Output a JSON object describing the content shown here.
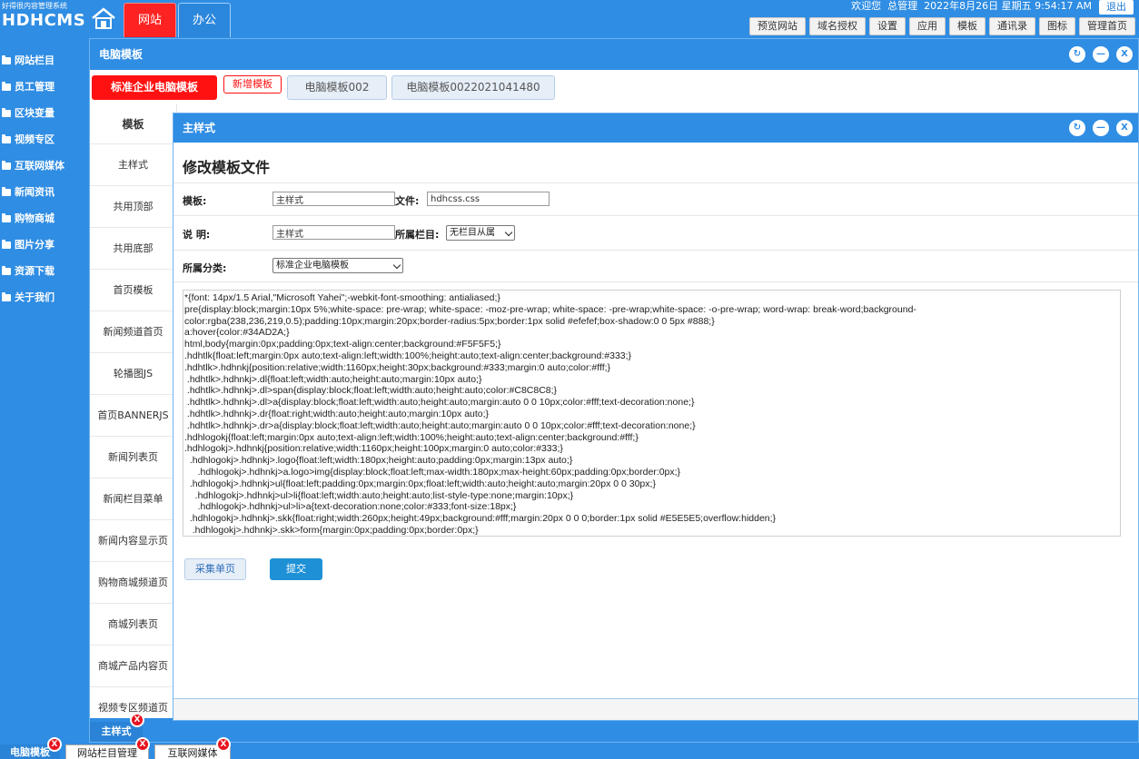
{
  "brand": {
    "subtitle": "好得很内容管理系统",
    "name": "HDHCMS"
  },
  "top_tabs": [
    "网站",
    "办公"
  ],
  "user": {
    "welcome": "欢迎您",
    "name": "总管理",
    "datetime": "2022年8月26日 星期五 9:54:17 AM",
    "logout": "退出"
  },
  "toolbar": [
    "预览网站",
    "域名授权",
    "设置",
    "应用",
    "模板",
    "通讯录",
    "图标",
    "管理首页"
  ],
  "left_nav": [
    "网站栏目",
    "员工管理",
    "区块变量",
    "视频专区",
    "互联网媒体",
    "新闻资讯",
    "购物商城",
    "图片分享",
    "资源下载",
    "关于我们"
  ],
  "outer_window": {
    "title": "电脑模板",
    "sub_tabs": [
      "标准企业电脑模板",
      "新增模板",
      "电脑模板002",
      "电脑模板0022021041480"
    ],
    "template_list_header": "模板",
    "template_list": [
      "主样式",
      "共用顶部",
      "共用底部",
      "首页模板",
      "新闻频道首页",
      "轮播图JS",
      "首页BANNERJS",
      "新闻列表页",
      "新闻栏目菜单",
      "新闻内容显示页",
      "购物商城频道页",
      "商城列表页",
      "商城产品内容页",
      "视频专区频道页"
    ],
    "inner_tab": "主样式"
  },
  "inner_window": {
    "title": "主样式",
    "form_title": "修改模板文件",
    "fields": {
      "template_label": "模板:",
      "template_value": "主样式",
      "file_label": "文件:",
      "file_value": "hdhcss.css",
      "desc_label": "说 明:",
      "desc_value": "主样式",
      "column_label": "所属栏目:",
      "column_value": "无栏目从属",
      "category_label": "所属分类:",
      "category_value": "标准企业电脑模板"
    },
    "code": "*{font: 14px/1.5 Arial,\"Microsoft Yahei\";-webkit-font-smoothing: antialiased;}\npre{display:block;margin:10px 5%;white-space: pre-wrap; white-space: -moz-pre-wrap; white-space: -pre-wrap;white-space: -o-pre-wrap; word-wrap: break-word;background-\ncolor:rgba(238,236,219,0.5);padding:10px;margin:20px;border-radius:5px;border:1px solid #efefef;box-shadow:0 0 5px #888;}\na:hover{color:#34AD2A;}\nhtml,body{margin:0px;padding:0px;text-align:center;background:#F5F5F5;}\n.hdhtlk{float:left;margin:0px auto;text-align:left;width:100%;height:auto;text-align:center;background:#333;}\n.hdhtlk>.hdhnkj{position:relative;width:1160px;height:30px;background:#333;margin:0 auto;color:#fff;}\n .hdhtlk>.hdhnkj>.dl{float:left;width:auto;height:auto;margin:10px auto;}\n .hdhtlk>.hdhnkj>.dl>span{display:block;float:left;width:auto;height:auto;color:#C8C8C8;}\n .hdhtlk>.hdhnkj>.dl>a{display:block;float:left;width:auto;height:auto;margin:auto 0 0 10px;color:#fff;text-decoration:none;}\n .hdhtlk>.hdhnkj>.dr{float:right;width:auto;height:auto;margin:10px auto;}\n .hdhtlk>.hdhnkj>.dr>a{display:block;float:left;width:auto;height:auto;margin:auto 0 0 10px;color:#fff;text-decoration:none;}\n.hdhlogokj{float:left;margin:0px auto;text-align:left;width:100%;height:auto;text-align:center;background:#fff;}\n.hdhlogokj>.hdhnkj{position:relative;width:1160px;height:100px;margin:0 auto;color:#333;}\n  .hdhlogokj>.hdhnkj>.logo{float:left;width:180px;height:auto;padding:0px;margin:13px auto;}\n     .hdhlogokj>.hdhnkj>a.logo>img{display:block;float:left;max-width:180px;max-height:60px;padding:0px;border:0px;}\n  .hdhlogokj>.hdhnkj>ul{float:left;padding:0px;margin:0px;float:left;width:auto;height:auto;margin:20px 0 0 30px;}\n    .hdhlogokj>.hdhnkj>ul>li{float:left;width:auto;height:auto;list-style-type:none;margin:10px;}\n     .hdhlogokj>.hdhnkj>ul>li>a{text-decoration:none;color:#333;font-size:18px;}\n  .hdhlogokj>.hdhnkj>.skk{float:right;width:260px;height:49px;background:#fff;margin:20px 0 0 0;border:1px solid #E5E5E5;overflow:hidden;}\n   .hdhlogokj>.hdhnkj>.skk>form{margin:0px;padding:0px;border:0px;}\n   .hdhlogokj>.hdhnkj>.skk>form>.sel{margin:0px;padding:0px;float:left;padding:14px 10px;border:0px;width:177px;border-left:1px solid #e5e5e5;}",
    "buttons": {
      "collect": "采集单页",
      "submit": "提交"
    }
  },
  "taskbar": [
    "电脑模板",
    "网站栏目管理",
    "互联网媒体"
  ],
  "icons": {
    "refresh": "↻",
    "minimize": "—",
    "close": "X"
  },
  "colors": {
    "primary": "#2f8de3",
    "danger": "#ff1111",
    "active_tab": "#ff2222"
  }
}
